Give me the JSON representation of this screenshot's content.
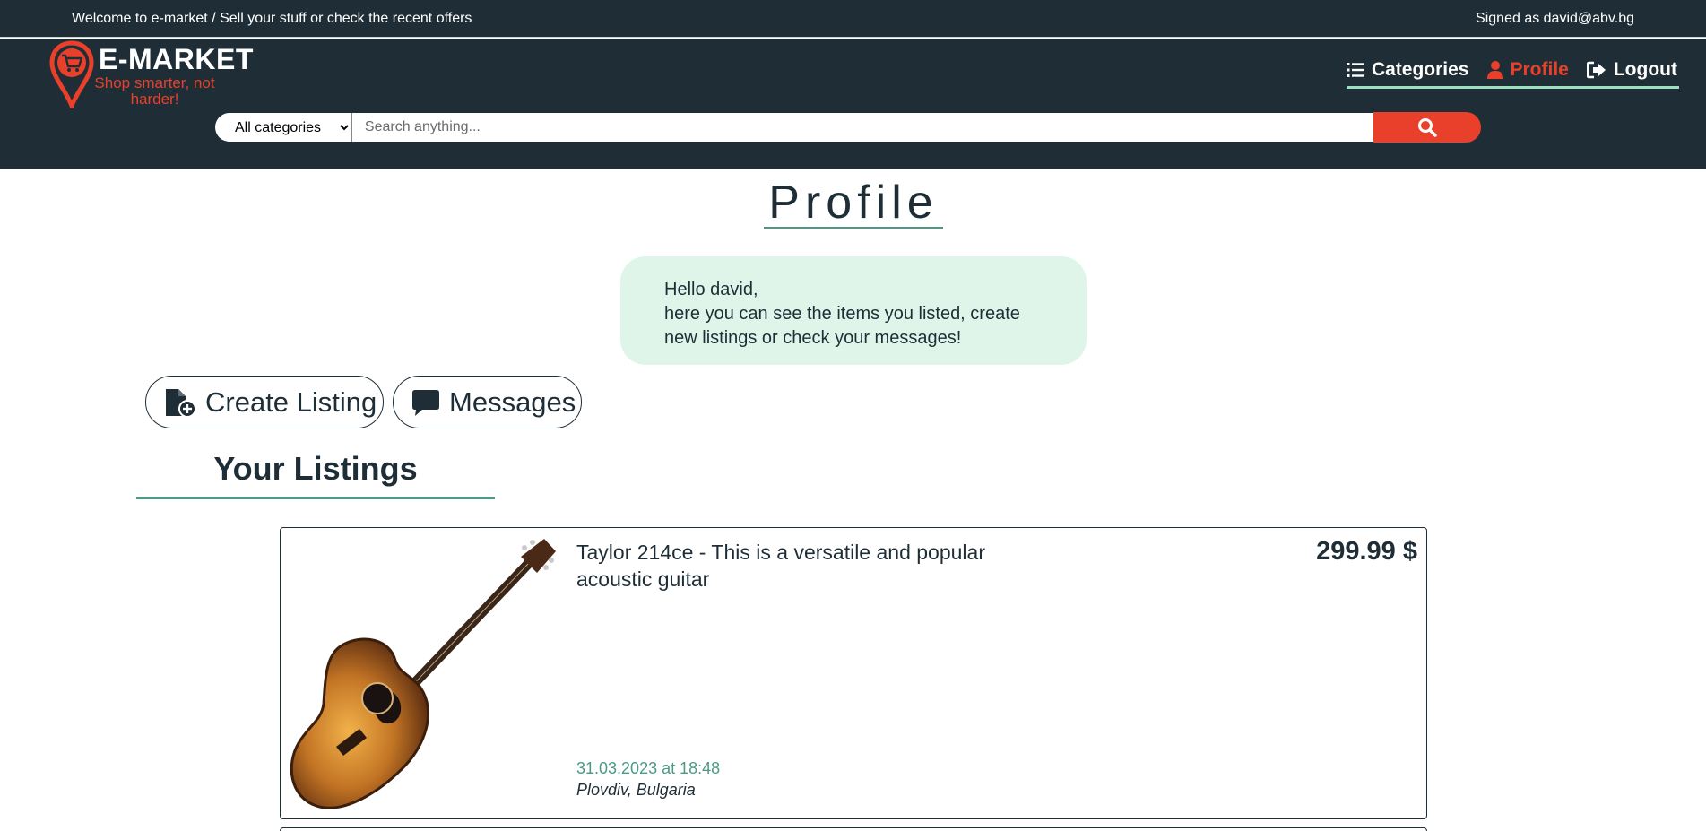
{
  "topbar": {
    "welcome": "Welcome to e-market / Sell your stuff or check the recent offers",
    "signed_in": "Signed as david@abv.bg"
  },
  "brand": {
    "name": "E-MARKET",
    "tagline": "Shop smarter, not harder!",
    "accent_color": "#e8402a",
    "dark_color": "#1f2e36",
    "mint_color": "#9be0c0"
  },
  "nav": {
    "items": [
      {
        "label": "Categories",
        "icon": "list-icon",
        "active": false
      },
      {
        "label": "Profile",
        "icon": "user-icon",
        "active": true
      },
      {
        "label": "Logout",
        "icon": "logout-icon",
        "active": false
      }
    ]
  },
  "search": {
    "category_selected": "All categories",
    "placeholder": "Search anything..."
  },
  "profile": {
    "title": "Profile",
    "greeting_line1": "Hello david,",
    "greeting_line2": "here you can see the items you listed, create new listings or check your messages!"
  },
  "actions": {
    "create_label": "Create Listing",
    "messages_label": "Messages"
  },
  "listings": {
    "heading": "Your Listings",
    "items": [
      {
        "title": "Taylor 214ce - This is a versatile and popular acoustic guitar",
        "price": "299.99 $",
        "date": "31.03.2023 at 18:48",
        "location": "Plovdiv, Bulgaria",
        "image": "acoustic-guitar"
      }
    ]
  }
}
